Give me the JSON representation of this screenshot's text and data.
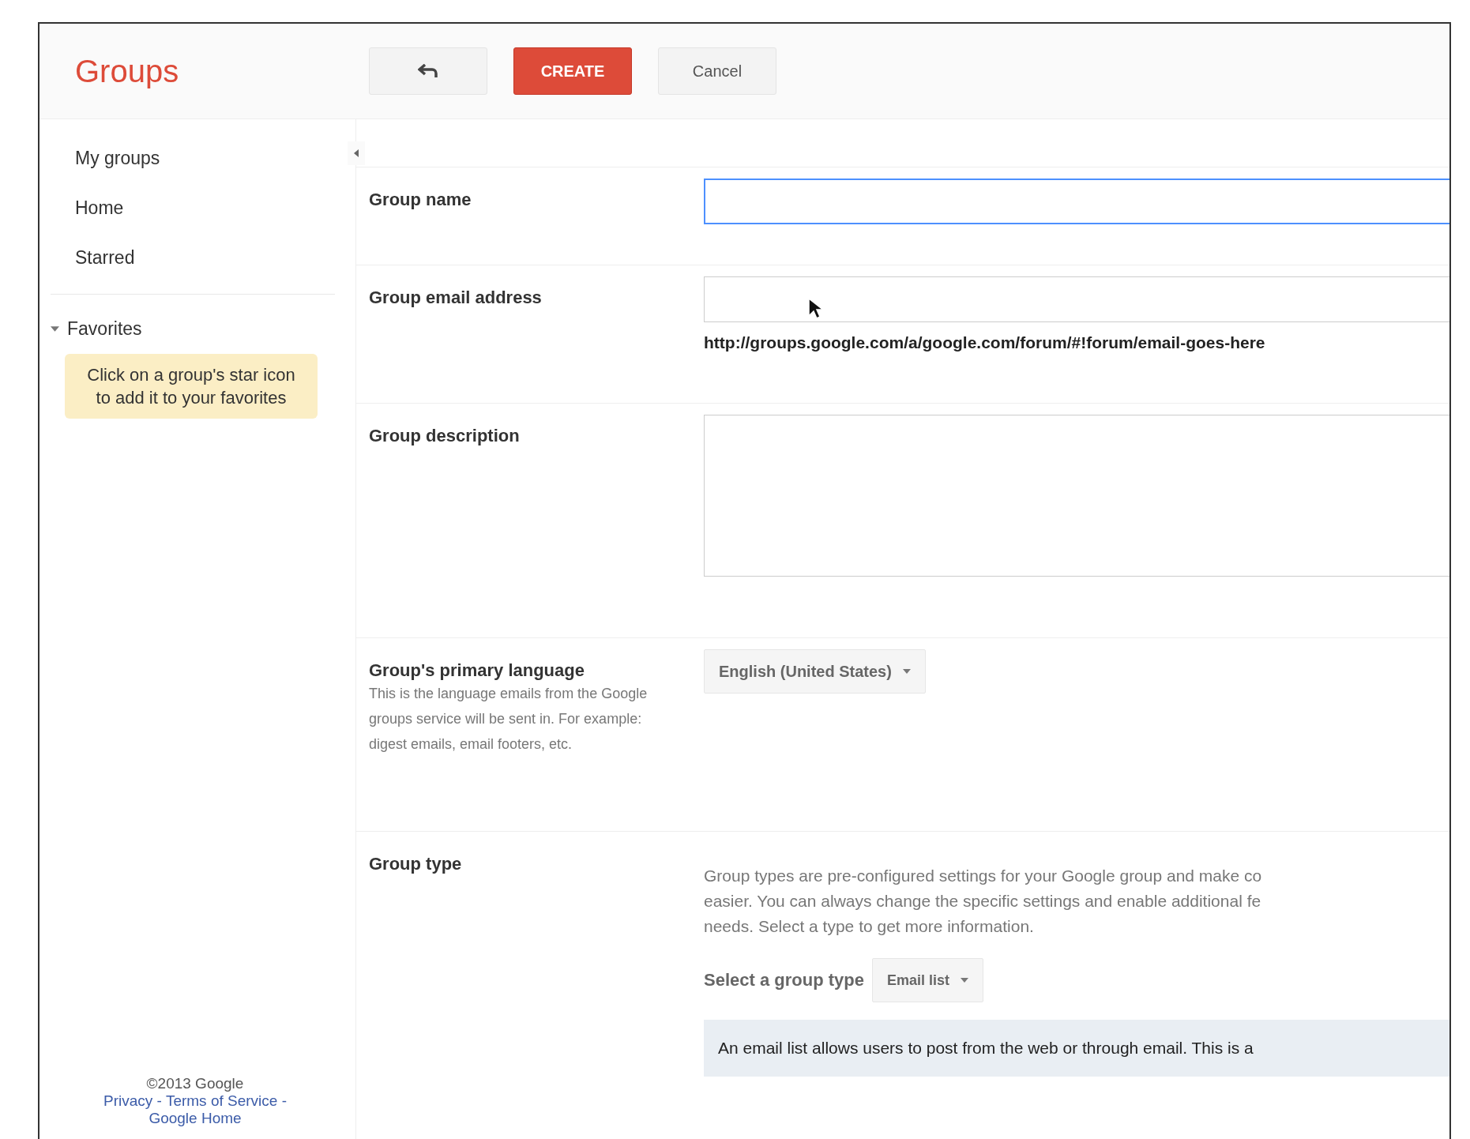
{
  "header": {
    "logo": "Groups",
    "buttons": [
      {
        "kind": "back"
      },
      {
        "kind": "primary",
        "label": "CREATE"
      },
      {
        "kind": "secondary",
        "label": "Cancel"
      }
    ]
  },
  "sidebar": {
    "nav": [
      {
        "label": "My groups"
      },
      {
        "label": "Home"
      },
      {
        "label": "Starred"
      }
    ],
    "favorites": {
      "label": "Favorites",
      "expanded": true,
      "hint": "Click on a group's star icon to add it to your favorites"
    },
    "footer": {
      "copyright": "©2013 Google",
      "separator": "-",
      "links": [
        "Privacy",
        "Terms of Service",
        "Google Home"
      ]
    }
  },
  "form": {
    "rows": [
      {
        "kind": "name",
        "label": "Group name",
        "focused": true
      },
      {
        "kind": "email",
        "label": "Group email address",
        "url": "http://groups.google.com/a/google.com/forum/#!forum/email-goes-here"
      },
      {
        "kind": "description",
        "label": "Group description"
      },
      {
        "kind": "language",
        "label": "Group's primary language",
        "help": "This is the language emails from the Google groups service will be sent in. For example: digest emails, email footers, etc.",
        "value": "English (United States)"
      },
      {
        "kind": "type",
        "label": "Group type",
        "lines": [
          "Group types are pre-configured settings for your Google group and make co",
          "easier. You can always change the specific settings and enable additional fe",
          "needs. Select a type to get more information."
        ],
        "select_label": "Select a group type",
        "value": "Email list",
        "info": "An email list allows users to post from the web or through email. This is a"
      }
    ]
  }
}
